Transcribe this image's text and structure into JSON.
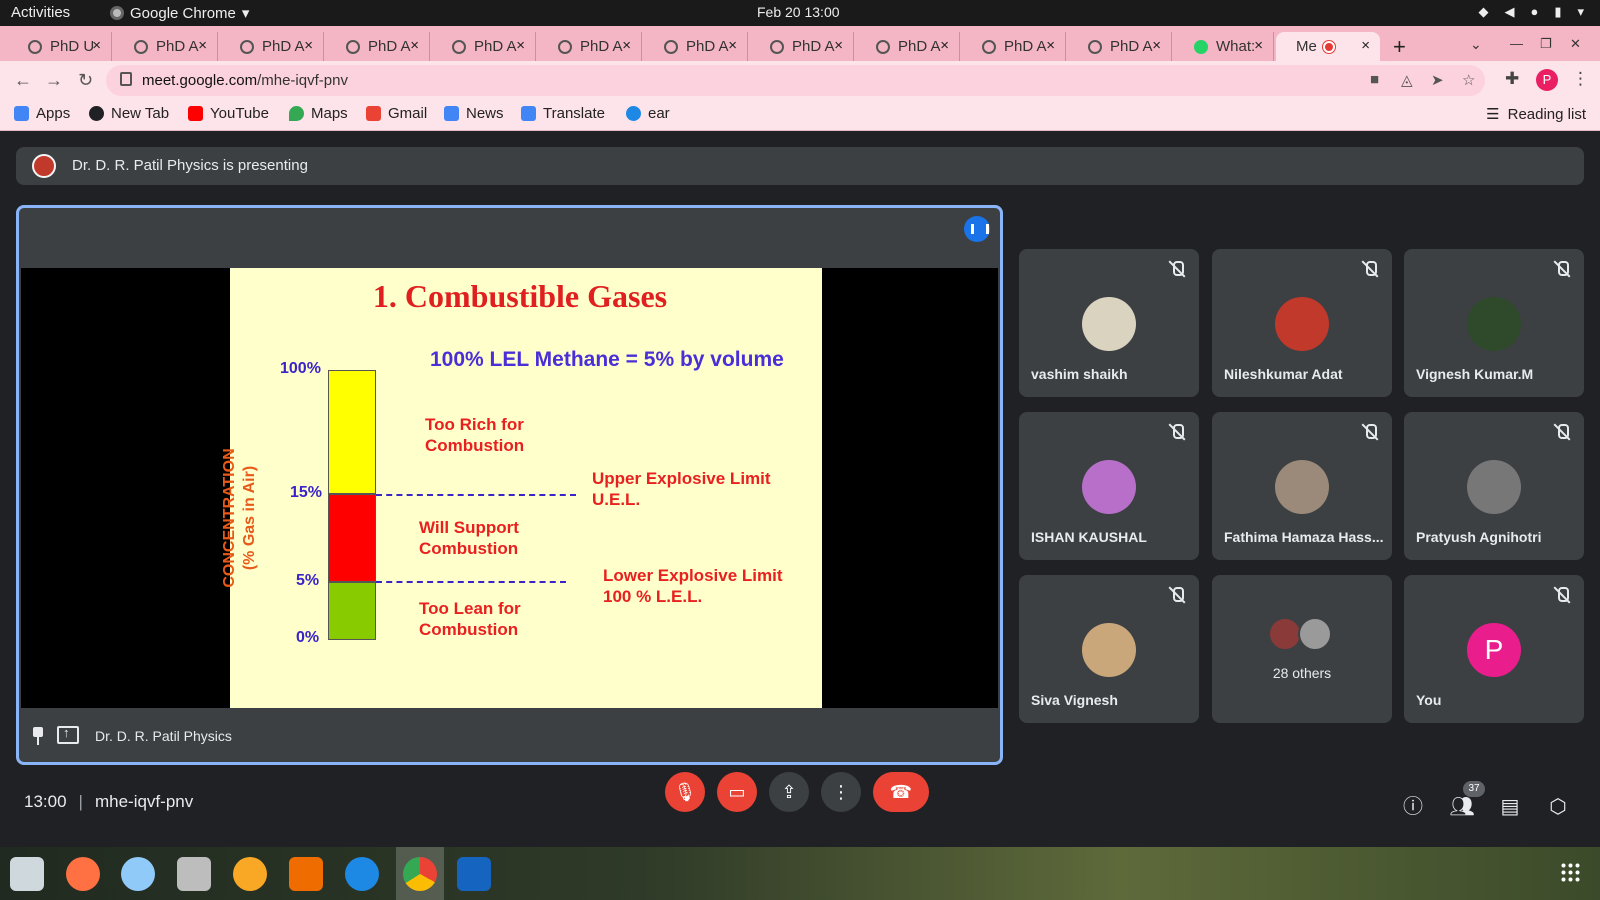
{
  "system": {
    "activities": "Activities",
    "app_menu": "Google Chrome",
    "clock": "Feb 20  13:00"
  },
  "browser": {
    "tabs": [
      {
        "label": "PhD U"
      },
      {
        "label": "PhD A"
      },
      {
        "label": "PhD A"
      },
      {
        "label": "PhD A"
      },
      {
        "label": "PhD A"
      },
      {
        "label": "PhD A"
      },
      {
        "label": "PhD A"
      },
      {
        "label": "PhD A"
      },
      {
        "label": "PhD A"
      },
      {
        "label": "PhD A"
      },
      {
        "label": "PhD A"
      },
      {
        "label": "What:"
      },
      {
        "label": "Me"
      }
    ],
    "url_host": "meet.google.com",
    "url_path": "/mhe-iqvf-pnv",
    "profile_initial": "P",
    "bookmarks": [
      {
        "label": "Apps",
        "color": "#4285f4"
      },
      {
        "label": "New Tab",
        "color": "#202124"
      },
      {
        "label": "YouTube",
        "color": "#ff0000"
      },
      {
        "label": "Maps",
        "color": "#34a853"
      },
      {
        "label": "Gmail",
        "color": "#ea4335"
      },
      {
        "label": "News",
        "color": "#4285f4"
      },
      {
        "label": "Translate",
        "color": "#4285f4"
      },
      {
        "label": "ear",
        "color": "#1e88e5"
      }
    ],
    "reading_list": "Reading list"
  },
  "meet": {
    "presenting_banner": "Dr. D. R. Patil Physics is presenting",
    "presenter_name": "Dr. D. R. Patil Physics",
    "meeting_time": "13:00",
    "meeting_code": "mhe-iqvf-pnv",
    "participants_count": "37",
    "participants": [
      {
        "name": "vashim shaikh",
        "avatar_color": "#d9d3c0"
      },
      {
        "name": "Nileshkumar Adat",
        "avatar_color": "#c0392b"
      },
      {
        "name": "Vignesh Kumar.M",
        "avatar_color": "#2e4a2a"
      },
      {
        "name": "ISHAN KAUSHAL",
        "avatar_color": "#b86fc9"
      },
      {
        "name": "Fathima Hamaza Hass...",
        "avatar_color": "#9b8a7a"
      },
      {
        "name": "Pratyush Agnihotri",
        "avatar_color": "#777777"
      },
      {
        "name": "Siva Vignesh",
        "avatar_color": "#c9a77a"
      }
    ],
    "others_label": "28 others",
    "you_label": "You",
    "you_initial": "P"
  },
  "slide": {
    "title": "1. Combustible Gases",
    "lel_note": "100% LEL Methane = 5% by volume",
    "ylabel_line1": "CONCENTRATION",
    "ylabel_line2": "(% Gas in Air)",
    "ticks": {
      "t100": "100%",
      "t15": "15%",
      "t5": "5%",
      "t0": "0%"
    },
    "zones": {
      "rich_1": "Too Rich for",
      "rich_2": "Combustion",
      "support_1": "Will Support",
      "support_2": "Combustion",
      "lean_1": "Too Lean for",
      "lean_2": "Combustion"
    },
    "uel_1": "Upper Explosive Limit",
    "uel_2": "U.E.L.",
    "lel_1": "Lower Explosive Limit",
    "lel_2": "100 % L.E.L.",
    "colors": {
      "rich": "#ffff00",
      "support": "#ff0000",
      "lean": "#88cc00"
    }
  }
}
